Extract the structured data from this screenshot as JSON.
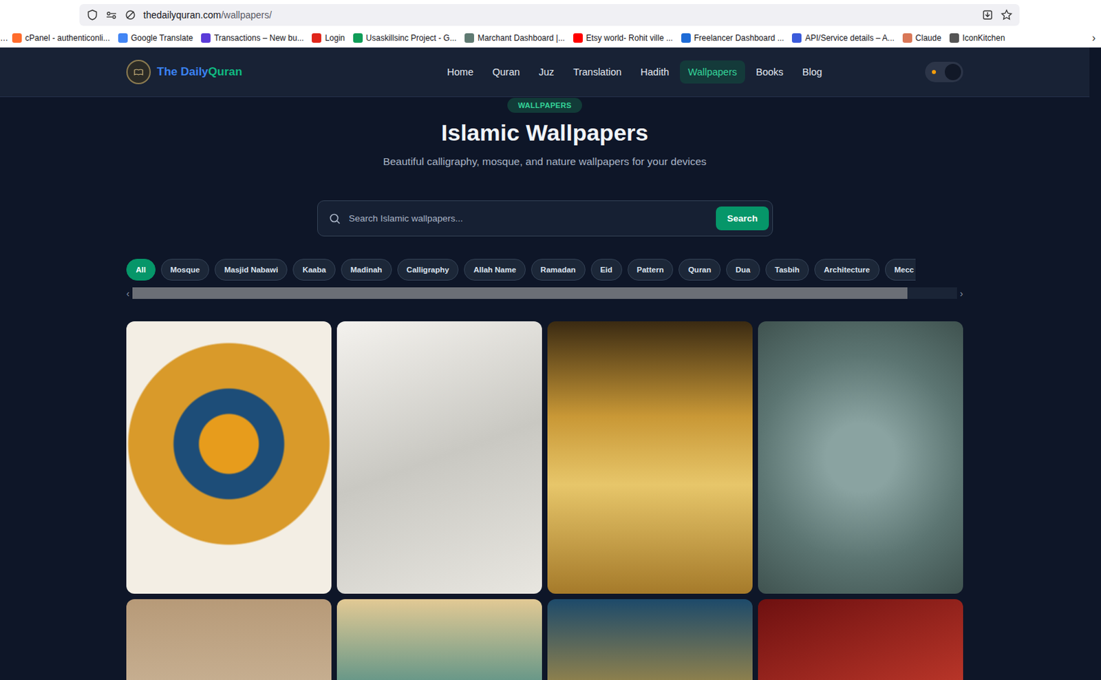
{
  "browser": {
    "url_host": "thedailyquran.com",
    "url_path": "/wallpapers/",
    "bookmarks_overflow_left": "…",
    "bookmarks": [
      {
        "label": "cPanel - authenticonli...",
        "color": "#ff6c2c"
      },
      {
        "label": "Google Translate",
        "color": "#4285f4"
      },
      {
        "label": "Transactions – New bu...",
        "color": "#5b3bd9"
      },
      {
        "label": "Login",
        "color": "#e0261b"
      },
      {
        "label": "Usaskillsinc Project - G...",
        "color": "#0f9d58"
      },
      {
        "label": "Marchant Dashboard |...",
        "color": "#5f7a72"
      },
      {
        "label": "Etsy world- Rohit ville ...",
        "color": "#ff0000"
      },
      {
        "label": "Freelancer Dashboard ...",
        "color": "#1e6bd6"
      },
      {
        "label": "API/Service details – A...",
        "color": "#3b5bdb"
      },
      {
        "label": "Claude",
        "color": "#d97757"
      },
      {
        "label": "IconKitchen",
        "color": "#555555"
      }
    ],
    "bookmarks_more": "›"
  },
  "site": {
    "logo": {
      "part1": "The Daily",
      "part2": "Quran"
    },
    "nav": [
      {
        "label": "Home",
        "selected": false
      },
      {
        "label": "Quran",
        "selected": false
      },
      {
        "label": "Juz",
        "selected": false
      },
      {
        "label": "Translation",
        "selected": false
      },
      {
        "label": "Hadith",
        "selected": false
      },
      {
        "label": "Wallpapers",
        "selected": true
      },
      {
        "label": "Books",
        "selected": false
      },
      {
        "label": "Blog",
        "selected": false
      }
    ],
    "theme_toggle": {
      "dark": true
    }
  },
  "hero": {
    "badge": "WALLPAPERS",
    "title": "Islamic Wallpapers",
    "subtitle": "Beautiful calligraphy, mosque, and nature wallpapers for your devices"
  },
  "search": {
    "placeholder": "Search Islamic wallpapers...",
    "button": "Search"
  },
  "filters": {
    "chips": [
      {
        "label": "All",
        "selected": true
      },
      {
        "label": "Mosque",
        "selected": false
      },
      {
        "label": "Masjid Nabawi",
        "selected": false
      },
      {
        "label": "Kaaba",
        "selected": false
      },
      {
        "label": "Madinah",
        "selected": false
      },
      {
        "label": "Calligraphy",
        "selected": false
      },
      {
        "label": "Allah Name",
        "selected": false
      },
      {
        "label": "Ramadan",
        "selected": false
      },
      {
        "label": "Eid",
        "selected": false
      },
      {
        "label": "Pattern",
        "selected": false
      },
      {
        "label": "Quran",
        "selected": false
      },
      {
        "label": "Dua",
        "selected": false
      },
      {
        "label": "Tasbih",
        "selected": false
      },
      {
        "label": "Architecture",
        "selected": false
      },
      {
        "label": "Mecc",
        "selected": false
      }
    ],
    "scroll_left": "‹",
    "scroll_right": "›",
    "scroll_level": 0.94
  },
  "wallpapers": [
    {
      "kind": "photo"
    },
    {
      "kind": "photo"
    },
    {
      "kind": "photo"
    },
    {
      "kind": "photo"
    },
    {
      "kind": "photo"
    },
    {
      "kind": "photo"
    },
    {
      "kind": "photo"
    },
    {
      "kind": "photo"
    }
  ]
}
